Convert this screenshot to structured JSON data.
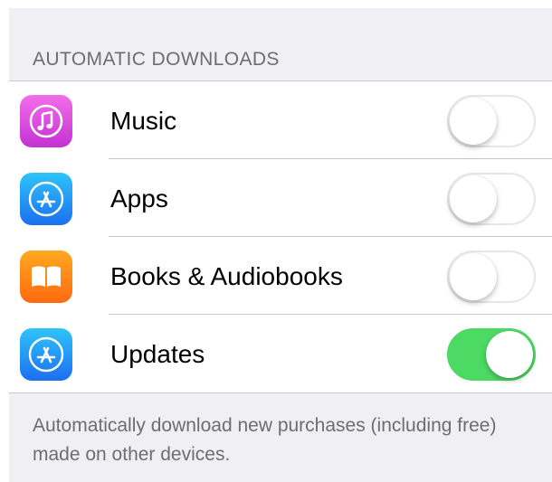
{
  "section": {
    "header": "AUTOMATIC DOWNLOADS",
    "footer": "Automatically download new purchases (including free) made on other devices."
  },
  "rows": [
    {
      "label": "Music",
      "icon": "itunes-music-icon",
      "enabled": false
    },
    {
      "label": "Apps",
      "icon": "app-store-icon",
      "enabled": false
    },
    {
      "label": "Books & Audiobooks",
      "icon": "ibooks-icon",
      "enabled": false
    },
    {
      "label": "Updates",
      "icon": "app-store-icon",
      "enabled": true
    }
  ],
  "colors": {
    "background": "#efeff4",
    "toggle_on": "#4cd964",
    "music_icon": "#e04bd8",
    "app_store_icon": "#1e8bf5",
    "books_icon": "#ff8a10"
  }
}
